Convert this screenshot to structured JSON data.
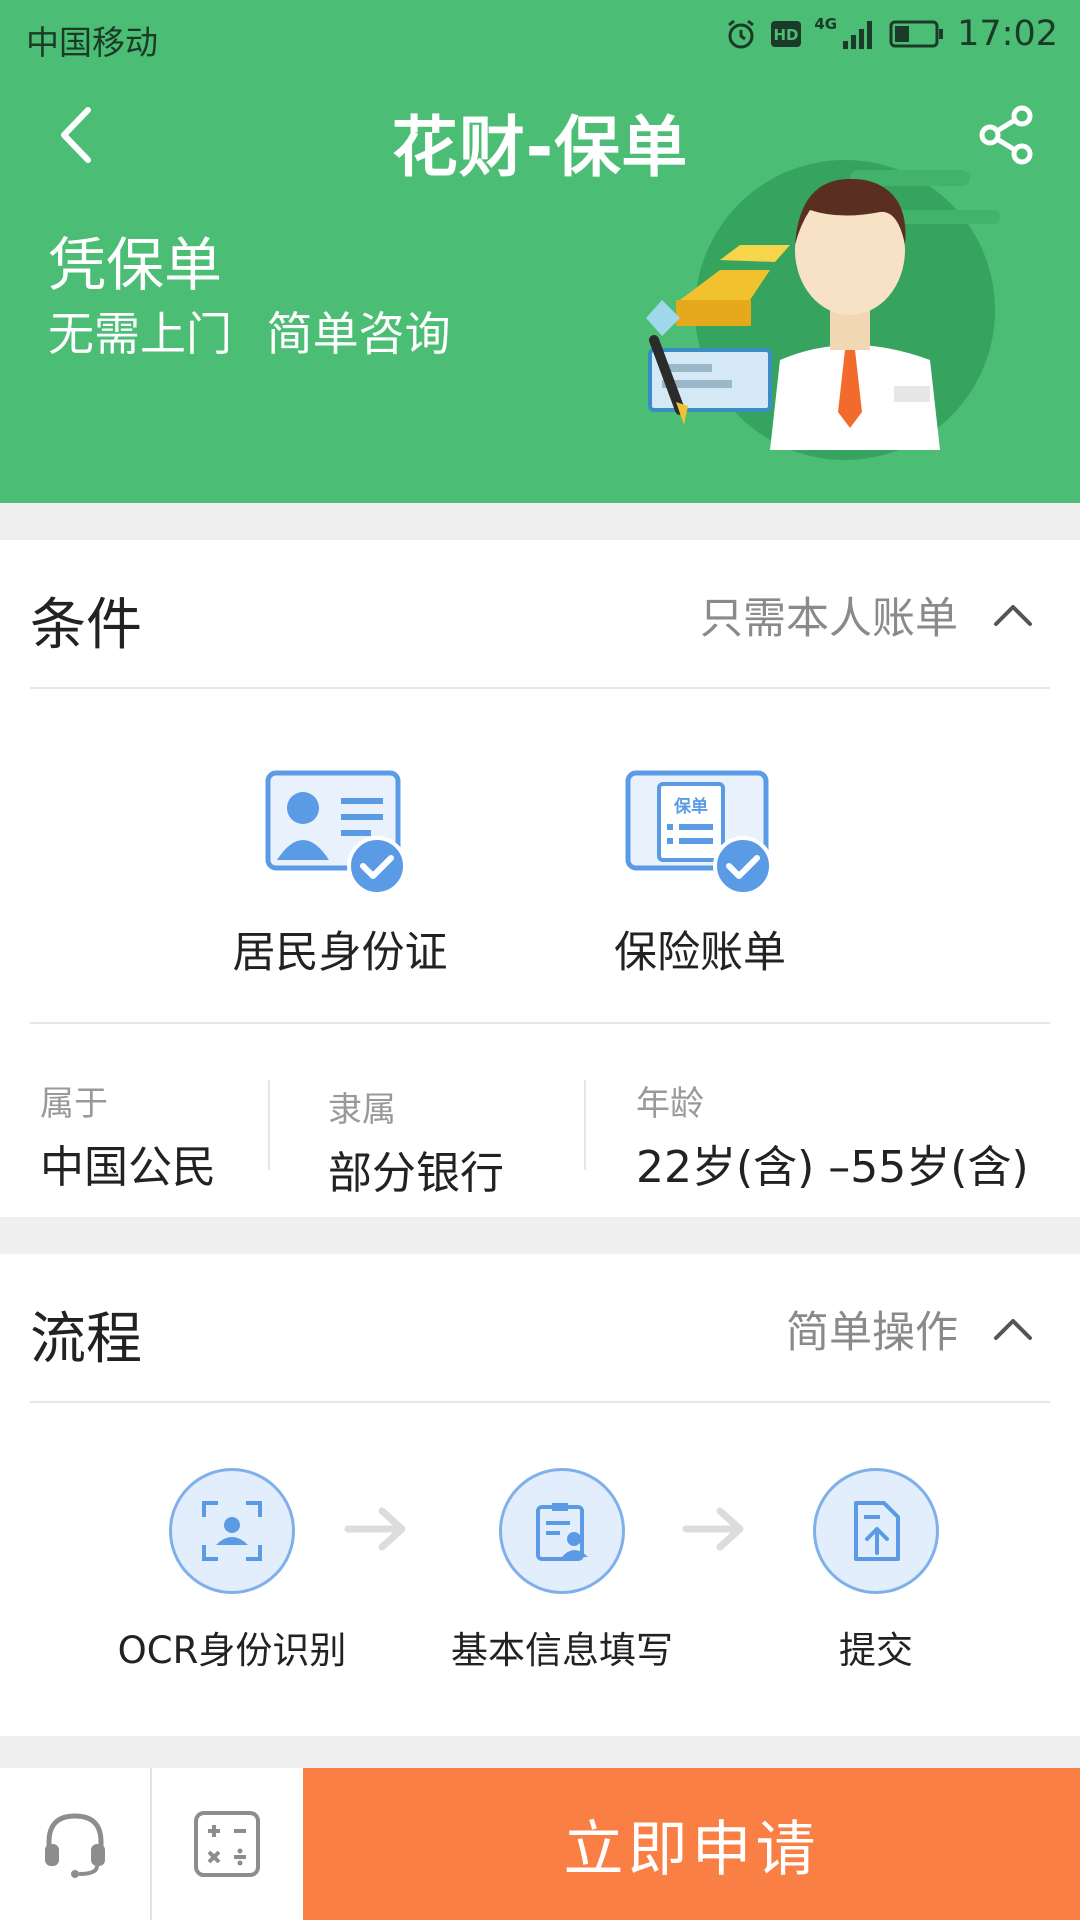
{
  "status_bar": {
    "carrier": "中国移动",
    "network": "4G",
    "time": "17:02"
  },
  "nav": {
    "title": "花财-保单"
  },
  "promo": {
    "title": "凭保单",
    "subtitle": "无需上门  简单咨询"
  },
  "conditions": {
    "title": "条件",
    "hint": "只需本人账单",
    "documents": [
      {
        "label": "居民身份证",
        "icon": "id-card-check-icon"
      },
      {
        "label": "保险账单",
        "icon": "policy-bill-check-icon",
        "icon_text": "保单"
      }
    ],
    "info": [
      {
        "label": "属于",
        "value": "中国公民"
      },
      {
        "label": "隶属",
        "value": "部分银行"
      },
      {
        "label": "年龄",
        "value": "22岁(含) –55岁(含)"
      }
    ]
  },
  "process": {
    "title": "流程",
    "hint": "简单操作",
    "steps": [
      {
        "label": "OCR身份识别",
        "icon": "ocr-scan-icon"
      },
      {
        "label": "基本信息填写",
        "icon": "form-fill-icon"
      },
      {
        "label": "提交",
        "icon": "submit-doc-icon"
      }
    ]
  },
  "bottom_bar": {
    "apply_label": "立即申请"
  },
  "colors": {
    "header_green": "#4bbd74",
    "apply_orange": "#f97f44",
    "icon_blue": "#5b9be6"
  }
}
